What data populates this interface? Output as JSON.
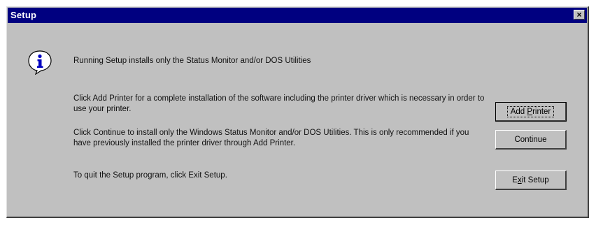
{
  "window": {
    "title": "Setup",
    "close_glyph": "×"
  },
  "icons": {
    "info": "info-icon",
    "close": "close-icon"
  },
  "messages": {
    "main": "Running Setup installs only the Status Monitor and/or DOS Utilities",
    "add_printer": "Click Add Printer for a complete installation of the software including the printer driver which is necessary in order to use your printer.",
    "continue": "Click Continue to install only the Windows Status Monitor and/or DOS Utilities. This is only recommended if you have previously installed the printer driver through Add Printer.",
    "quit": "To quit the Setup program, click Exit Setup."
  },
  "buttons": {
    "add_printer": {
      "prefix": "Add ",
      "accel": "P",
      "suffix": "rinter"
    },
    "continue": {
      "label": "Continue"
    },
    "exit_setup": {
      "prefix": "E",
      "accel": "x",
      "suffix": "it Setup"
    }
  },
  "colors": {
    "titlebar": "#000080",
    "face": "#c0c0c0"
  }
}
